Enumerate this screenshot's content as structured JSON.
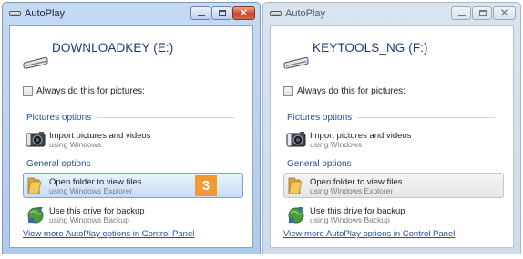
{
  "windows": [
    {
      "title": "AutoPlay",
      "drive_label": "DOWNLOADKEY (E:)",
      "always_checkbox_label": "Always do this for pictures:",
      "pictures_section_title": "Pictures options",
      "import_option": {
        "label": "Import pictures and videos",
        "sublabel": "using Windows"
      },
      "general_section_title": "General options",
      "open_folder_option": {
        "label": "Open folder to view files",
        "sublabel": "using Windows Explorer"
      },
      "backup_option": {
        "label": "Use this drive for backup",
        "sublabel": "using Windows Backup"
      },
      "control_panel_link": "View more AutoPlay options in Control Panel",
      "callout_number": "3",
      "state": "active"
    },
    {
      "title": "AutoPlay",
      "drive_label": "KEYTOOLS_NG (F:)",
      "always_checkbox_label": "Always do this for pictures:",
      "pictures_section_title": "Pictures options",
      "import_option": {
        "label": "Import pictures and videos",
        "sublabel": "using Windows"
      },
      "general_section_title": "General options",
      "open_folder_option": {
        "label": "Open folder to view files",
        "sublabel": "using Windows Explorer"
      },
      "backup_option": {
        "label": "Use this drive for backup",
        "sublabel": "using Windows Backup"
      },
      "control_panel_link": "View more AutoPlay options in Control Panel",
      "state": "inactive"
    }
  ],
  "icons": {
    "title": "usb-drive-icon",
    "drive": "usb-drive-icon",
    "import": "camera-icon",
    "open_folder": "folder-icon",
    "backup": "backup-globe-icon"
  },
  "colors": {
    "link": "#1a4fa8",
    "section_heading": "#1f4f9a",
    "callout_badge": "#f29a2e",
    "highlight_fill": "#c8dcf3",
    "close_button_active": "#c9452d"
  }
}
